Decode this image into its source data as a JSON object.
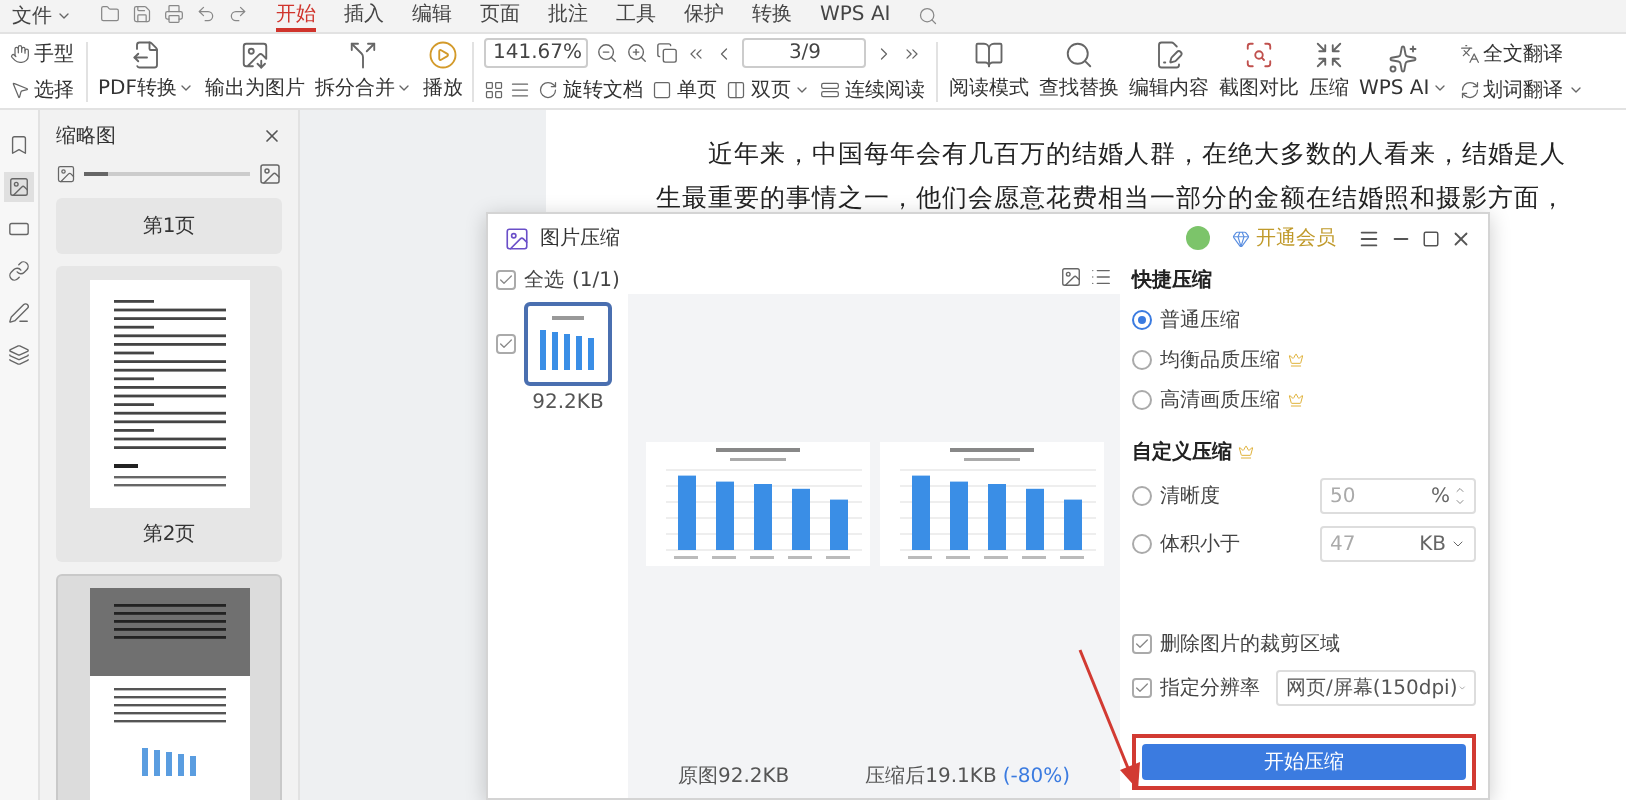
{
  "menu_bar": {
    "file_menu": "文件",
    "tabs": [
      {
        "label": "开始",
        "selected": true
      },
      {
        "label": "插入",
        "selected": false
      },
      {
        "label": "编辑",
        "selected": false
      },
      {
        "label": "页面",
        "selected": false
      },
      {
        "label": "批注",
        "selected": false
      },
      {
        "label": "工具",
        "selected": false
      },
      {
        "label": "保护",
        "selected": false
      },
      {
        "label": "转换",
        "selected": false
      },
      {
        "label": "WPS AI",
        "selected": false
      }
    ]
  },
  "toolbar": {
    "tools": [
      {
        "label": "手型"
      },
      {
        "label": "选择"
      }
    ],
    "left_buttons": [
      {
        "label": "PDF转换",
        "dropdown": true
      },
      {
        "label": "输出为图片",
        "dropdown": false
      },
      {
        "label": "拆分合并",
        "dropdown": true
      },
      {
        "label": "播放",
        "dropdown": false
      }
    ],
    "zoom": "141.67%",
    "page": "3/9",
    "view_buttons": [
      {
        "label": "旋转文档",
        "dropdown": false
      },
      {
        "label": "单页",
        "dropdown": false
      },
      {
        "label": "双页",
        "dropdown": true
      },
      {
        "label": "连续阅读",
        "dropdown": false
      }
    ],
    "right_buttons": [
      {
        "label": "阅读模式",
        "dropdown": false
      },
      {
        "label": "查找替换",
        "dropdown": false
      },
      {
        "label": "编辑内容",
        "dropdown": false
      },
      {
        "label": "截图对比",
        "dropdown": false
      },
      {
        "label": "压缩",
        "dropdown": false
      },
      {
        "label": "WPS AI",
        "dropdown": true
      }
    ],
    "translate": [
      {
        "label": "全文翻译",
        "dropdown": false
      },
      {
        "label": "划词翻译",
        "dropdown": true
      }
    ]
  },
  "side_tools": [
    {
      "selected": false
    },
    {
      "selected": true
    },
    {
      "selected": false
    },
    {
      "selected": false
    },
    {
      "selected": false
    },
    {
      "selected": false
    }
  ],
  "thumbnails": {
    "title": "缩略图",
    "slider": {
      "level": 0.15
    },
    "pages": [
      {
        "kind": "label",
        "label": "第1页",
        "selected": false
      },
      {
        "kind": "text-page",
        "label": "第2页",
        "selected": false
      },
      {
        "kind": "chart-page",
        "selected": true
      }
    ]
  },
  "document": {
    "lines": [
      "近年来，中国每年会有几百万的结婚人群，在绝大多数的人看来，结婚是人",
      "生最重要的事情之一，他们会愿意花费相当一部分的金额在结婚照和摄影方面，"
    ]
  },
  "dialog": {
    "title": "图片压缩",
    "member_button": "开通会员",
    "select_all": {
      "label": "全选",
      "count": "(1/1)",
      "checked": true
    },
    "images": [
      {
        "size": "92.2KB",
        "checked": true,
        "selected": true
      }
    ],
    "original_caption": "原图92.2KB",
    "compressed_caption": "压缩后19.1KB",
    "reduction": "(-80%)",
    "panel": {
      "quick_title": "快捷压缩",
      "quick_options": [
        {
          "label": "普通压缩",
          "selected": true,
          "premium": false
        },
        {
          "label": "均衡品质压缩",
          "selected": false,
          "premium": true
        },
        {
          "label": "高清画质压缩",
          "selected": false,
          "premium": true
        }
      ],
      "custom_title": "自定义压缩",
      "custom_premium": true,
      "custom_options": [
        {
          "kind": "stepper",
          "label": "清晰度",
          "selected": false,
          "value": "50",
          "unit": "%"
        },
        {
          "kind": "dropdown",
          "label": "体积小于",
          "selected": false,
          "value": "47",
          "unit": "KB"
        }
      ],
      "options": [
        {
          "label": "删除图片的裁剪区域",
          "checked": true
        },
        {
          "label": "指定分辨率",
          "checked": true,
          "select": "网页/屏幕(150dpi)"
        }
      ],
      "start_button": "开始压缩"
    }
  }
}
